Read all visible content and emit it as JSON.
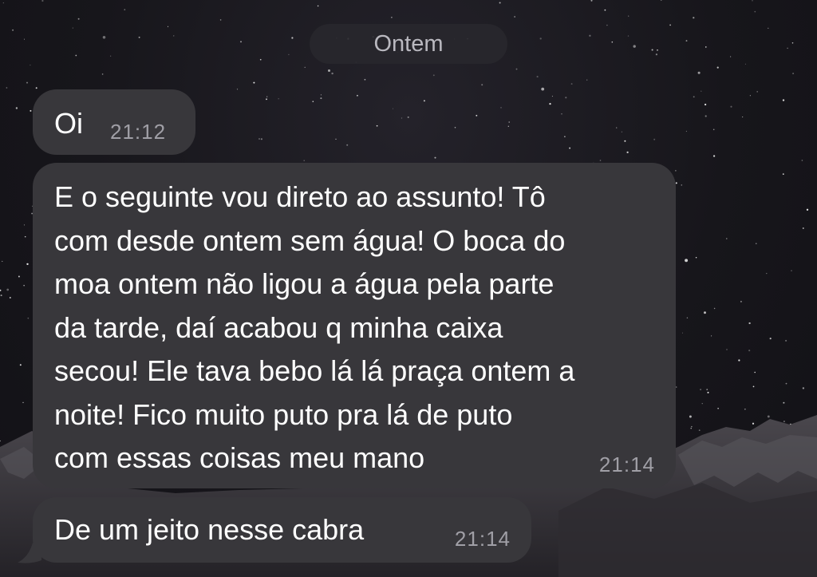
{
  "chat": {
    "date_separator": "Ontem",
    "messages": [
      {
        "text": "Oi",
        "time": "21:12"
      },
      {
        "text": "E o seguinte vou direto ao assunto! Tô\ncom desde ontem sem água! O boca do\nmoa ontem não ligou a água pela parte\nda tarde, daí acabou q minha caixa\nsecou! Ele tava bebo lá lá praça ontem a\nnoite! Fico muito puto pra lá de puto\ncom essas coisas meu mano",
        "time": "21:14"
      },
      {
        "text": "De um jeito nesse cabra",
        "time": "21:14"
      }
    ]
  },
  "colors": {
    "bubble": "#38373b",
    "timestamp": "#a09fa6",
    "message_text": "#ffffff",
    "date_pill_text": "#b9b8bf"
  }
}
